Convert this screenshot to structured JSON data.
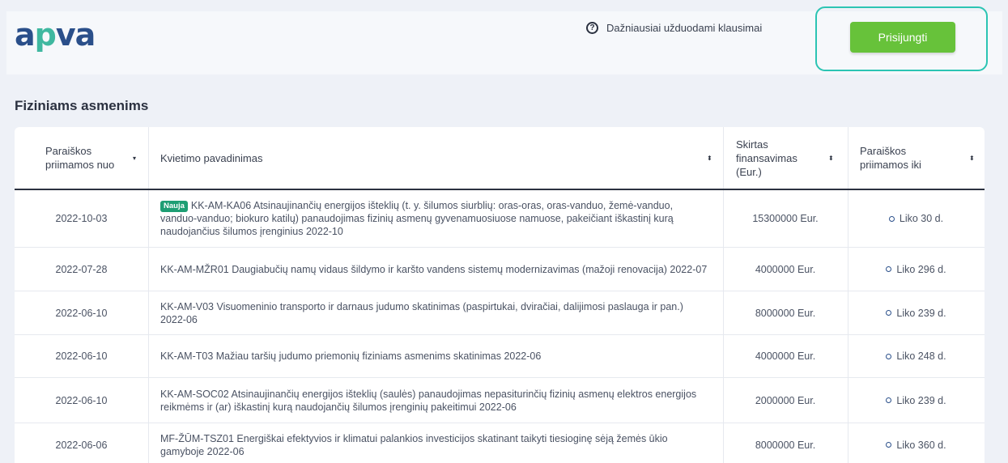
{
  "header": {
    "logo_part1": "a",
    "logo_part2": "p",
    "logo_part3": "va",
    "faq_icon": "?",
    "faq_label": "Dažniausiai užduodami klausimai",
    "login_label": "Prisijungti"
  },
  "section": {
    "title": "Fiziniams asmenims"
  },
  "table": {
    "columns": [
      {
        "label": "Paraiškos priimamos nuo",
        "sort_icon": "▾"
      },
      {
        "label": "Kvietimo pavadinimas",
        "sort_icon": "⬍"
      },
      {
        "label": "Skirtas finansavimas (Eur.)",
        "sort_icon": "⬍"
      },
      {
        "label": "Paraiškos priimamos iki",
        "sort_icon": "⬍"
      }
    ],
    "rows": [
      {
        "date": "2022-10-03",
        "badge": "Nauja",
        "name": "KK-AM-KA06 Atsinaujinančių energijos išteklių (t. y. šilumos siurblių: oras-oras, oras-vanduo, žemė-vanduo, vanduo-vanduo; biokuro katilų) panaudojimas fizinių asmenų gyvenamuosiuose namuose, pakeičiant iškastinį kurą naudojančius šilumos įrenginius 2022-10",
        "amount": "15300000 Eur.",
        "remaining": "Liko 30 d."
      },
      {
        "date": "2022-07-28",
        "badge": "",
        "name": "KK-AM-MŽR01 Daugiabučių namų vidaus šildymo ir karšto vandens sistemų modernizavimas (mažoji renovacija) 2022-07",
        "amount": "4000000 Eur.",
        "remaining": "Liko 296 d."
      },
      {
        "date": "2022-06-10",
        "badge": "",
        "name": "KK-AM-V03 Visuomeninio transporto ir darnaus judumo skatinimas (paspirtukai, dviračiai, dalijimosi paslauga ir pan.) 2022-06",
        "amount": "8000000 Eur.",
        "remaining": "Liko 239 d."
      },
      {
        "date": "2022-06-10",
        "badge": "",
        "name": "KK-AM-T03 Mažiau taršių judumo priemonių fiziniams asmenims skatinimas 2022-06",
        "amount": "4000000 Eur.",
        "remaining": "Liko 248 d."
      },
      {
        "date": "2022-06-10",
        "badge": "",
        "name": "KK-AM-SOC02 Atsinaujinančių energijos išteklių (saulės) panaudojimas nepasiturinčių fizinių asmenų elektros energijos reikmėms ir (ar) iškastinį kurą naudojančių šilumos įrenginių pakeitimui 2022-06",
        "amount": "2000000 Eur.",
        "remaining": "Liko 239 d."
      },
      {
        "date": "2022-06-06",
        "badge": "",
        "name": "MF-ŽŪM-TSZ01 Energiškai efektyvios ir klimatui palankios investicijos skatinant taikyti tiesioginę sėją žemės ūkio gamyboje 2022-06",
        "amount": "8000000 Eur.",
        "remaining": "Liko 360 d."
      }
    ]
  },
  "colors": {
    "brand_blue": "#2a4f8a",
    "brand_teal": "#3fb8a0",
    "login_green": "#67c23a",
    "highlight": "#2bc4b3",
    "badge_green": "#1e9e74"
  }
}
